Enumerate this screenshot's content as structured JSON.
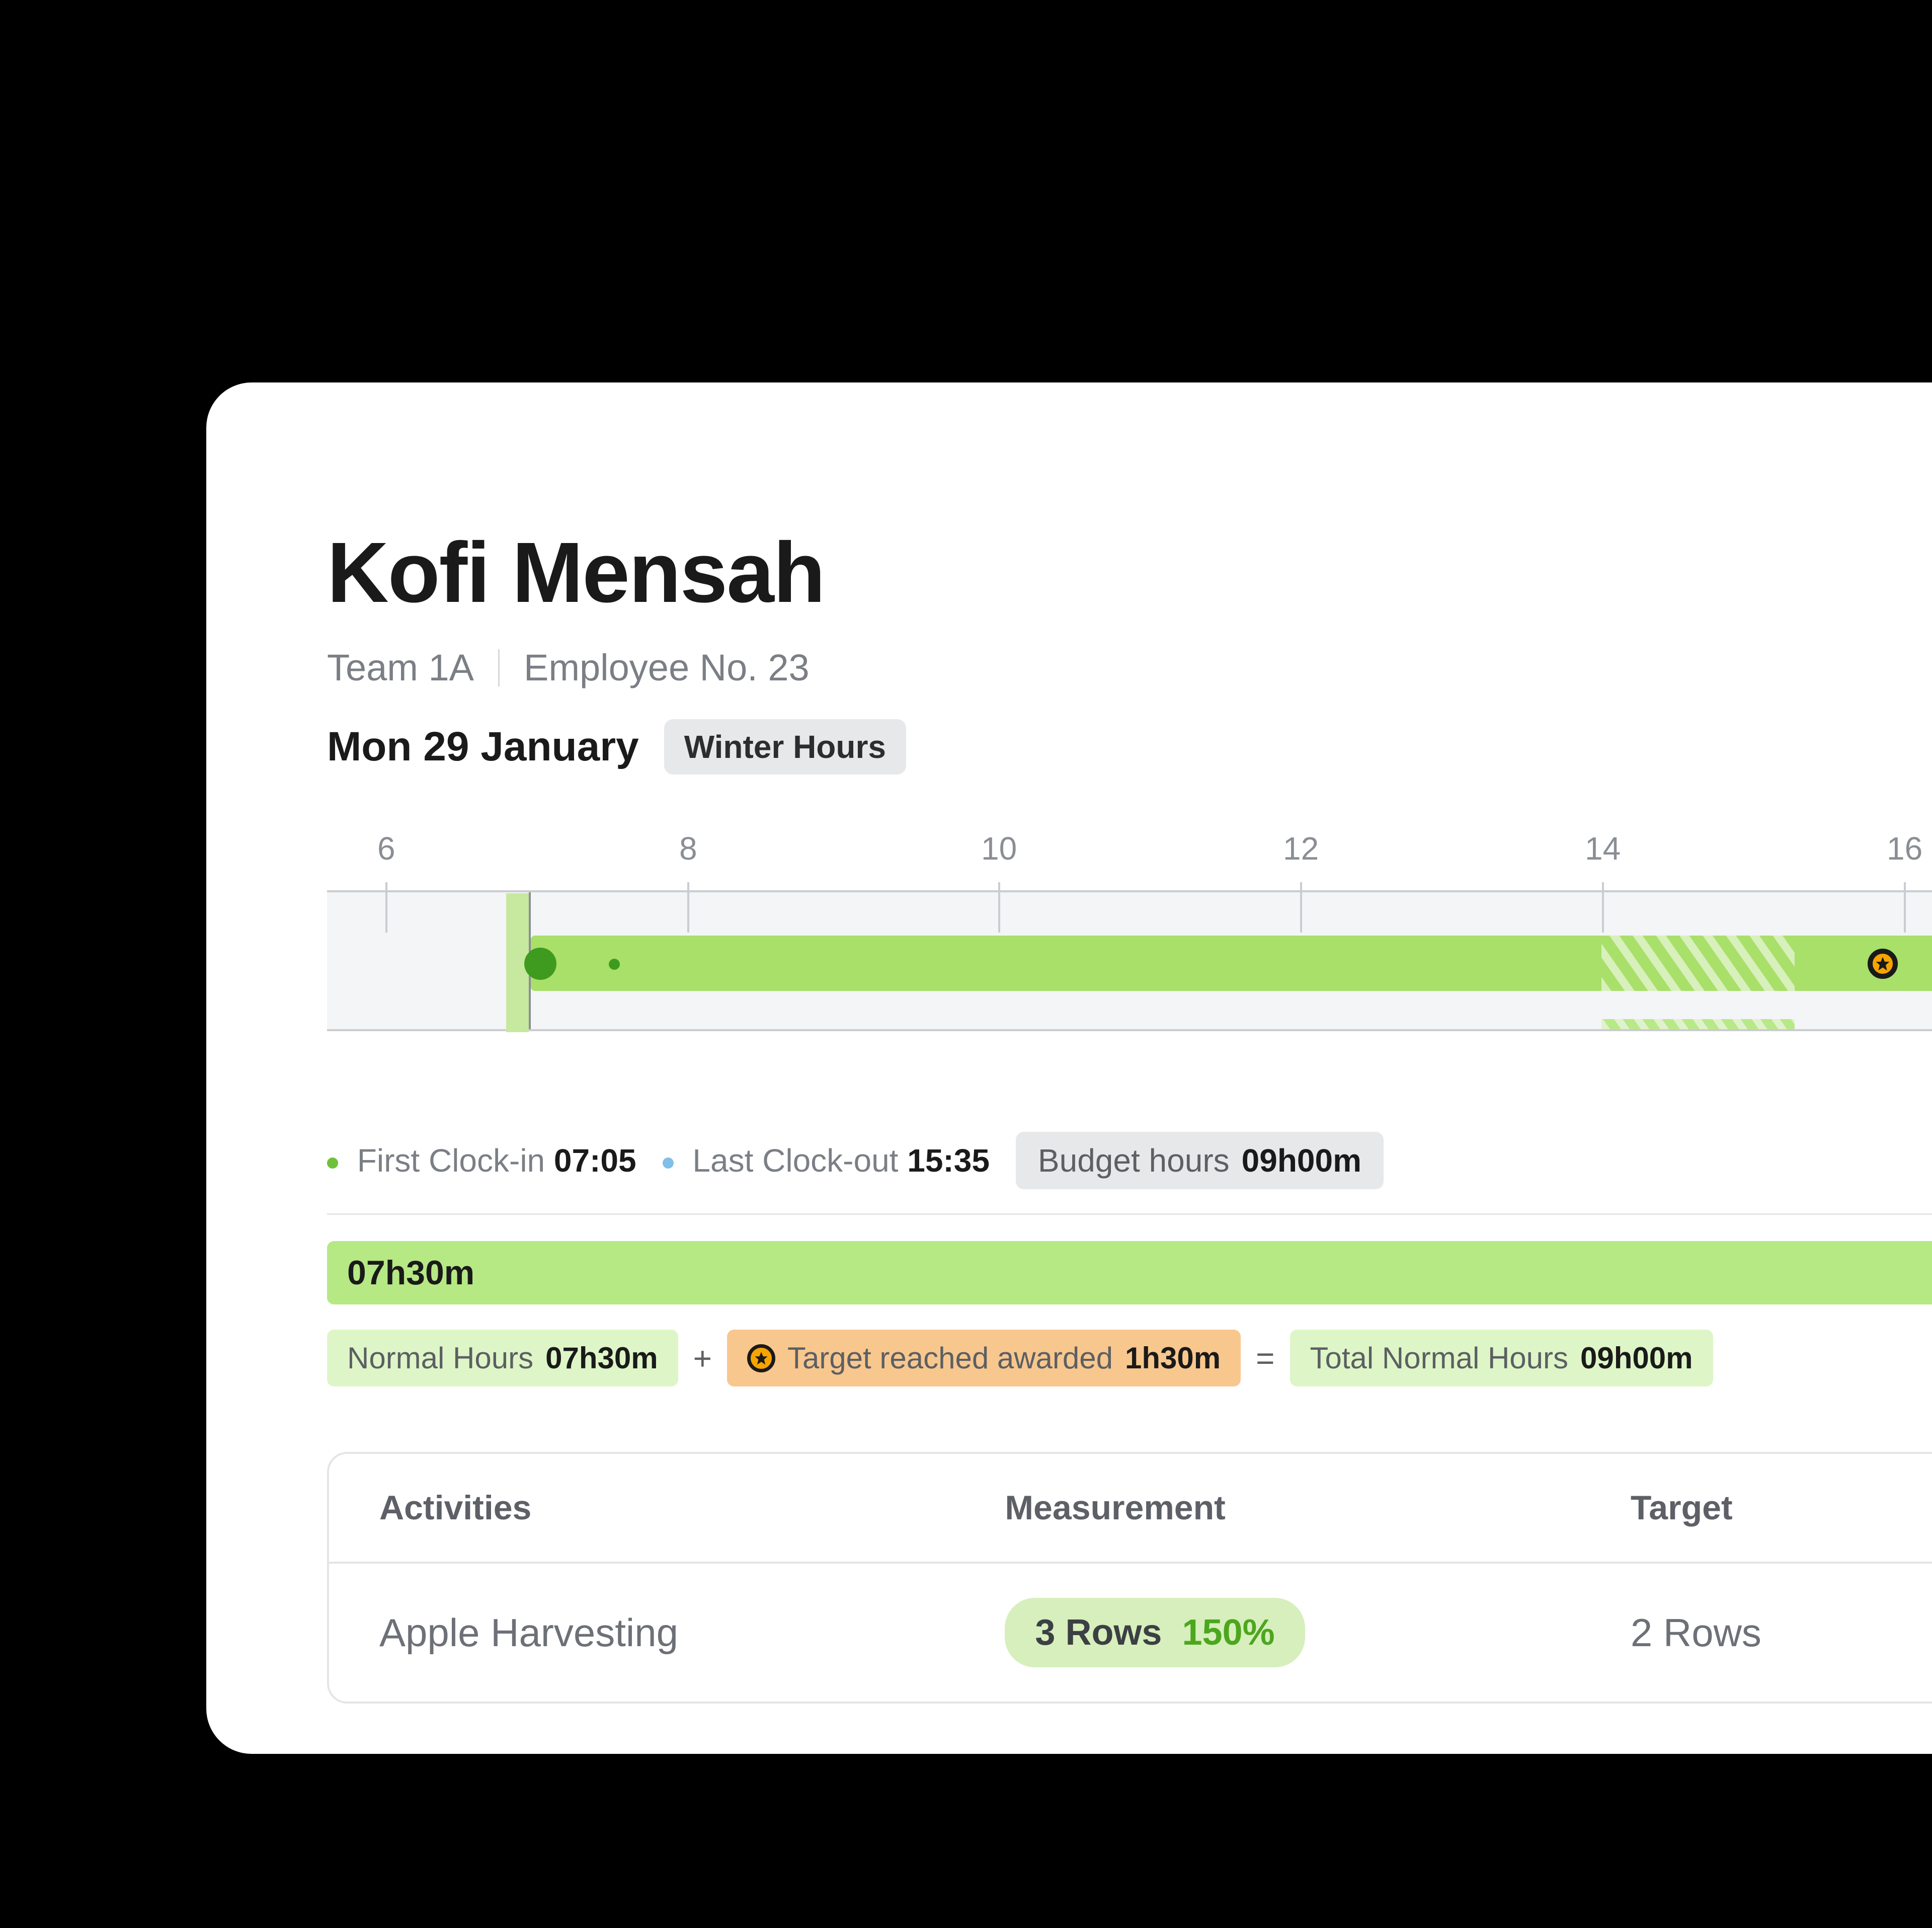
{
  "employee": {
    "name": "Kofi Mensah",
    "team": "Team 1A",
    "number_label": "Employee No. 23"
  },
  "date": {
    "label": "Mon 29 January",
    "season_badge": "Winter Hours"
  },
  "timeline": {
    "ticks": [
      "6",
      "8",
      "10",
      "12",
      "14",
      "16"
    ]
  },
  "clock_stats": {
    "first_in_label": "First Clock-in",
    "first_in_time": "07:05",
    "last_out_label": "Last Clock-out",
    "last_out_time": "15:35",
    "budget_label": "Budget hours",
    "budget_value": "09h00m"
  },
  "hours_bars": {
    "normal_value": "07h30m",
    "award_truncated": "0"
  },
  "breakdown": {
    "normal_label": "Normal Hours",
    "normal_value": "07h30m",
    "plus": "+",
    "target_label": "Target reached awarded",
    "target_value": "1h30m",
    "equals": "=",
    "total_label": "Total Normal Hours",
    "total_value": "09h00m"
  },
  "activities": {
    "headers": {
      "activity": "Activities",
      "measurement": "Measurement",
      "target": "Target"
    },
    "rows": [
      {
        "name": "Apple Harvesting",
        "count": "3 Rows",
        "pct": "150%",
        "target": "2 Rows"
      }
    ]
  }
}
